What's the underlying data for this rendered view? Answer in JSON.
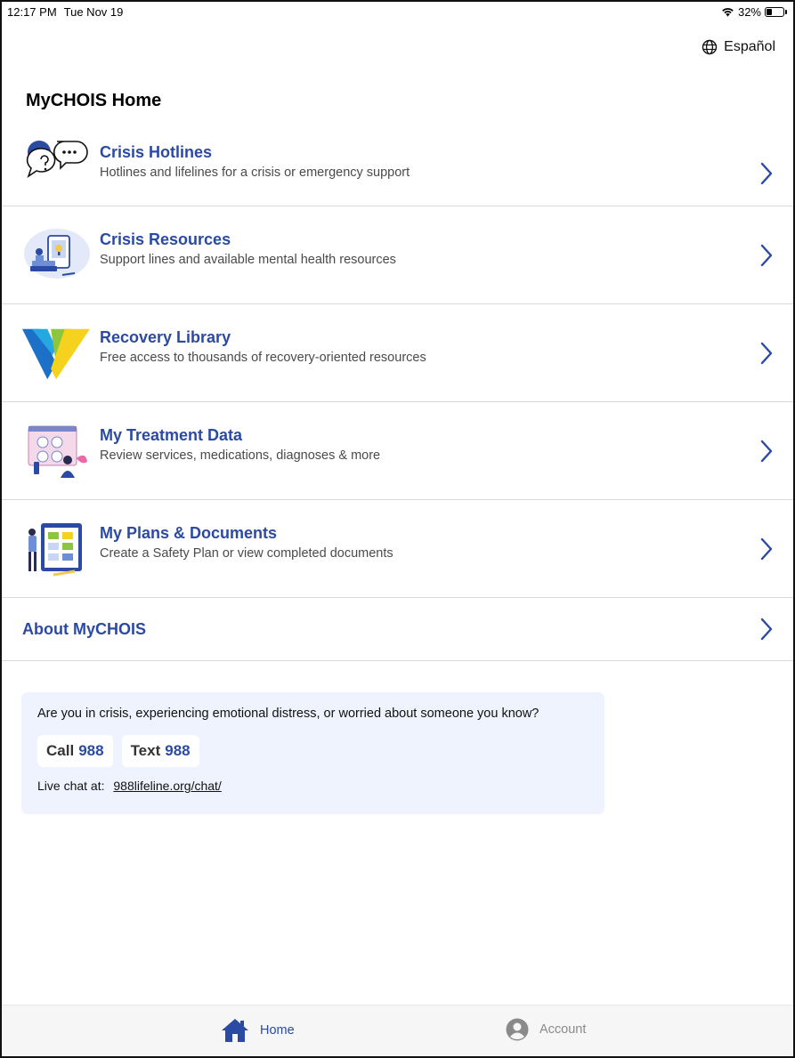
{
  "status_bar": {
    "time": "12:17 PM",
    "date": "Tue Nov 19",
    "battery_text": "32%",
    "battery_level": 0.32
  },
  "header": {
    "language_label": "Español",
    "title": "MyCHOIS Home"
  },
  "menu": [
    {
      "title": "Crisis Hotlines",
      "subtitle": "Hotlines and lifelines for a crisis or emergency support",
      "icon": "chat-bubbles-icon"
    },
    {
      "title": "Crisis Resources",
      "subtitle": "Support lines and available mental health resources",
      "icon": "resources-illustration"
    },
    {
      "title": "Recovery Library",
      "subtitle": "Free access to thousands of recovery-oriented resources",
      "icon": "triangle-logo"
    },
    {
      "title": "My Treatment Data",
      "subtitle": "Review services, medications, diagnoses & more",
      "icon": "treatment-illustration"
    },
    {
      "title": "My Plans & Documents",
      "subtitle": "Create a Safety Plan or view completed documents",
      "icon": "documents-illustration"
    }
  ],
  "about": {
    "title": "About MyCHOIS"
  },
  "crisis_card": {
    "question": "Are you in crisis, experiencing emotional distress, or worried about someone you know?",
    "call_label": "Call",
    "call_number": "988",
    "text_label": "Text",
    "text_number": "988",
    "chat_label": "Live chat at:",
    "chat_link": "988lifeline.org/chat/"
  },
  "tabs": {
    "home": "Home",
    "account": "Account"
  },
  "colors": {
    "accent": "#2b4aa3",
    "card_bg": "#eef3fd"
  }
}
